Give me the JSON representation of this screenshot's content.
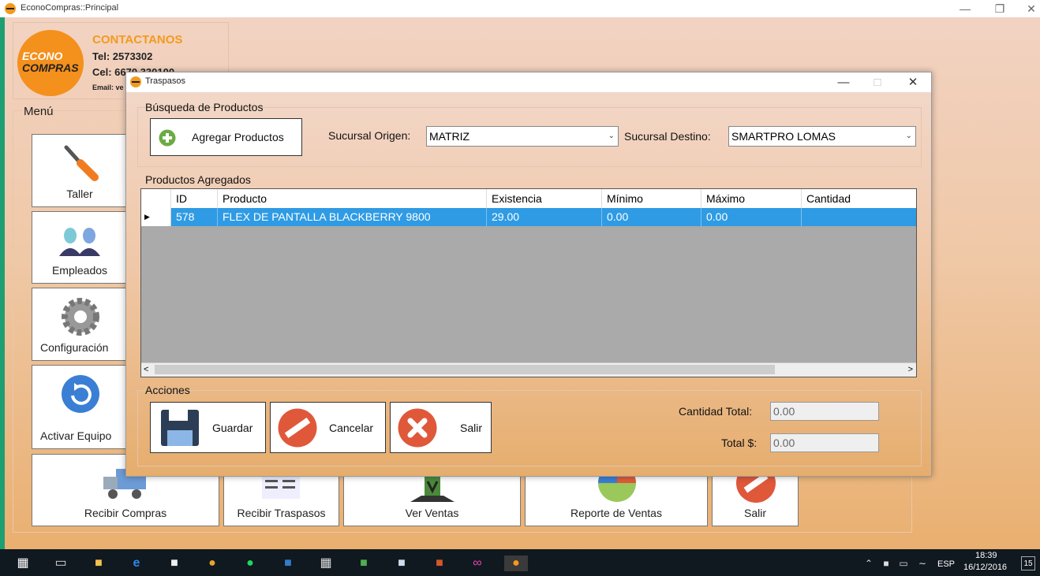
{
  "window": {
    "title": "EconoCompras::Principal"
  },
  "contact": {
    "logo_top": "ECONO",
    "logo_bottom": "COMPRAS",
    "title": "CONTACTANOS",
    "tel": "Tel: 2573302",
    "cel": "Cel: 6670 330100",
    "email": "Email: ve"
  },
  "menu": {
    "label": "Menú",
    "items": [
      {
        "label": "Taller",
        "icon": "screwdriver-icon"
      },
      {
        "label": "Empleados",
        "icon": "employees-icon"
      },
      {
        "label": "Configuración",
        "icon": "gear-icon"
      },
      {
        "label": "Activar Equipo",
        "icon": "refresh-icon"
      },
      {
        "label": "Recibir Compras",
        "icon": "truck-icon"
      },
      {
        "label": "Recibir Traspasos",
        "icon": "document-icon"
      },
      {
        "label": "Ver Ventas",
        "icon": "download-icon"
      },
      {
        "label": "Reporte de Ventas",
        "icon": "pie-chart-icon"
      },
      {
        "label": "Salir",
        "icon": "cancel-icon"
      }
    ]
  },
  "dialog": {
    "title": "Traspasos",
    "busqueda": {
      "group_title": "Búsqueda de Productos",
      "add_button": "Agregar Productos",
      "origen_label": "Sucursal Origen:",
      "origen_value": "MATRIZ",
      "destino_label": "Sucursal Destino:",
      "destino_value": "SMARTPRO LOMAS"
    },
    "productos": {
      "group_title": "Productos Agregados",
      "columns": [
        "ID",
        "Producto",
        "Existencia",
        "Mínimo",
        "Máximo",
        "Cantidad"
      ],
      "rows": [
        {
          "id": "578",
          "producto": "FLEX DE PANTALLA BLACKBERRY 9800",
          "existencia": "29.00",
          "minimo": "0.00",
          "maximo": "0.00",
          "cantidad": ""
        }
      ]
    },
    "acciones": {
      "group_title": "Acciones",
      "guardar": "Guardar",
      "cancelar": "Cancelar",
      "salir": "Salir",
      "cantidad_total_label": "Cantidad Total:",
      "cantidad_total_value": "0.00",
      "total_label": "Total $:",
      "total_value": "0.00"
    }
  },
  "taskbar": {
    "lang": "ESP",
    "time": "18:39",
    "date": "16/12/2016",
    "notif": "15"
  },
  "colors": {
    "accent_orange": "#f39a1e",
    "selection_blue": "#2f9be4",
    "cancel_red": "#e0583a"
  }
}
